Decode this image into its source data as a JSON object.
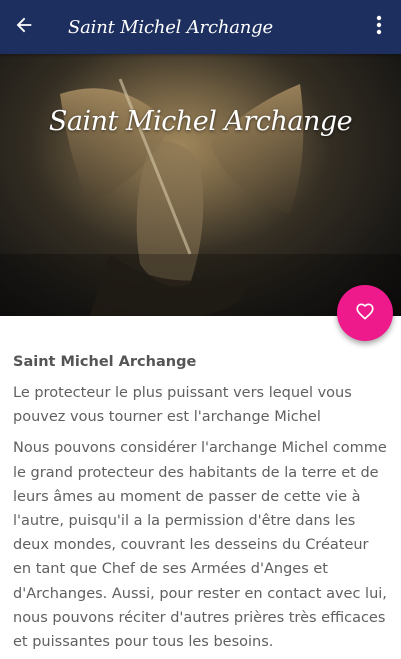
{
  "app_bar": {
    "title": "Saint Michel Archange",
    "back_icon": "arrow-left-icon",
    "menu_icon": "more-vertical-icon",
    "background_color": "#1d2f5e"
  },
  "hero": {
    "title": "Saint Michel Archange"
  },
  "fab": {
    "icon": "heart-outline-icon",
    "color": "#ee1a8c"
  },
  "article": {
    "heading": "Saint Michel Archange",
    "paragraphs": [
      "Le protecteur le plus puissant vers lequel vous pouvez vous tourner est l'archange Michel",
      "Nous pouvons considérer l'archange Michel comme le grand protecteur des habitants de la terre et de leurs âmes au moment de passer de cette vie à l'autre, puisqu'il a la permission d'être dans les deux mondes, couvrant les desseins du Créateur en tant que Chef de ses Armées d'Anges et d'Archanges. Aussi, pour rester en contact avec lui, nous pouvons réciter d'autres prières très efficaces et puissantes pour tous les besoins."
    ]
  }
}
